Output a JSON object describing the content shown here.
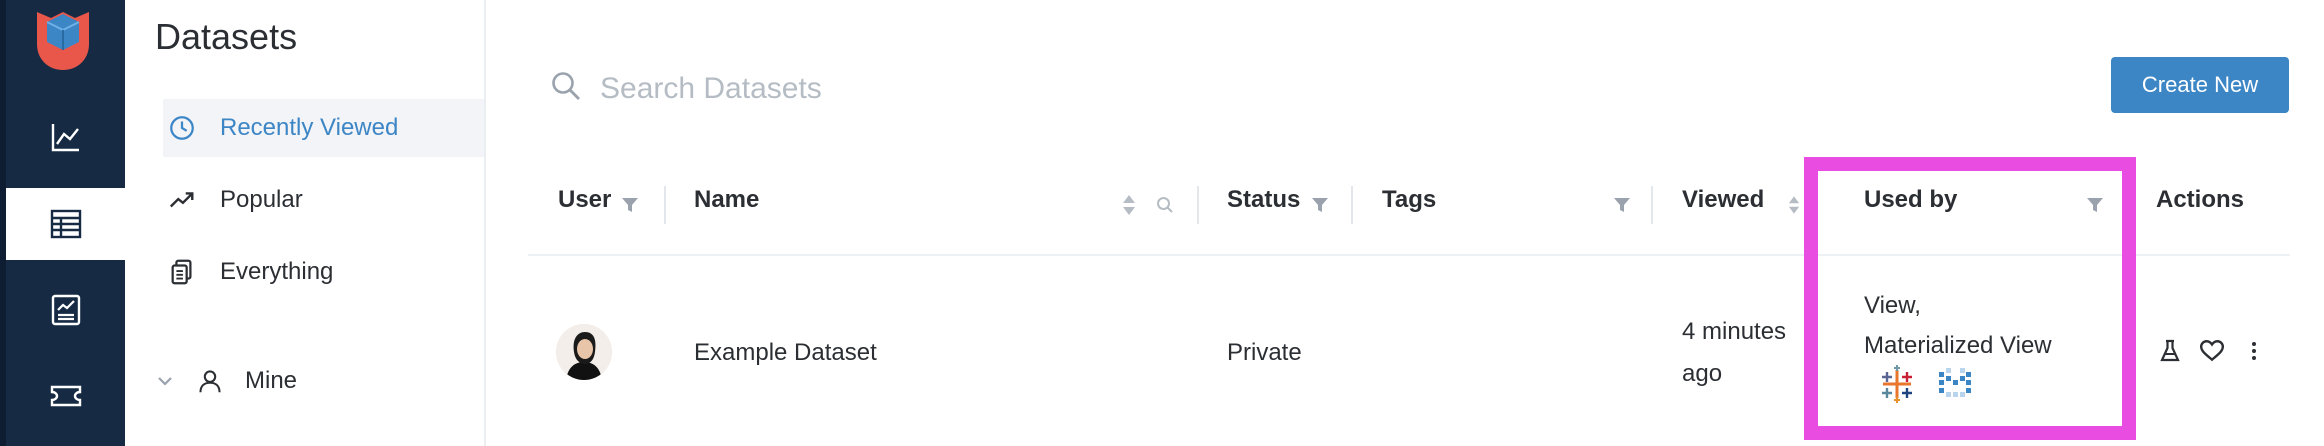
{
  "rail": {
    "items": [
      {
        "name": "analytics-icon"
      },
      {
        "name": "table-icon",
        "active": true
      },
      {
        "name": "report-icon"
      },
      {
        "name": "ticket-icon"
      }
    ]
  },
  "sidebar": {
    "title": "Datasets",
    "items": [
      {
        "label": "Recently Viewed",
        "icon": "clock-icon",
        "active": true
      },
      {
        "label": "Popular",
        "icon": "trend-icon"
      },
      {
        "label": "Everything",
        "icon": "copy-icon"
      }
    ],
    "mine_label": "Mine"
  },
  "search": {
    "placeholder": "Search Datasets"
  },
  "create_button": "Create New",
  "table": {
    "columns": {
      "user": "User",
      "name": "Name",
      "status": "Status",
      "tags": "Tags",
      "viewed": "Viewed",
      "used_by": "Used by",
      "actions": "Actions"
    },
    "rows": [
      {
        "name": "Example Dataset",
        "status": "Private",
        "viewed_line1": "4 minutes",
        "viewed_line2": "ago",
        "used_by_line1": "View,",
        "used_by_line2": "Materialized View"
      }
    ]
  },
  "colors": {
    "accent": "#3d86c6",
    "rail_bg": "#162a44",
    "highlight": "#e94ce0"
  }
}
